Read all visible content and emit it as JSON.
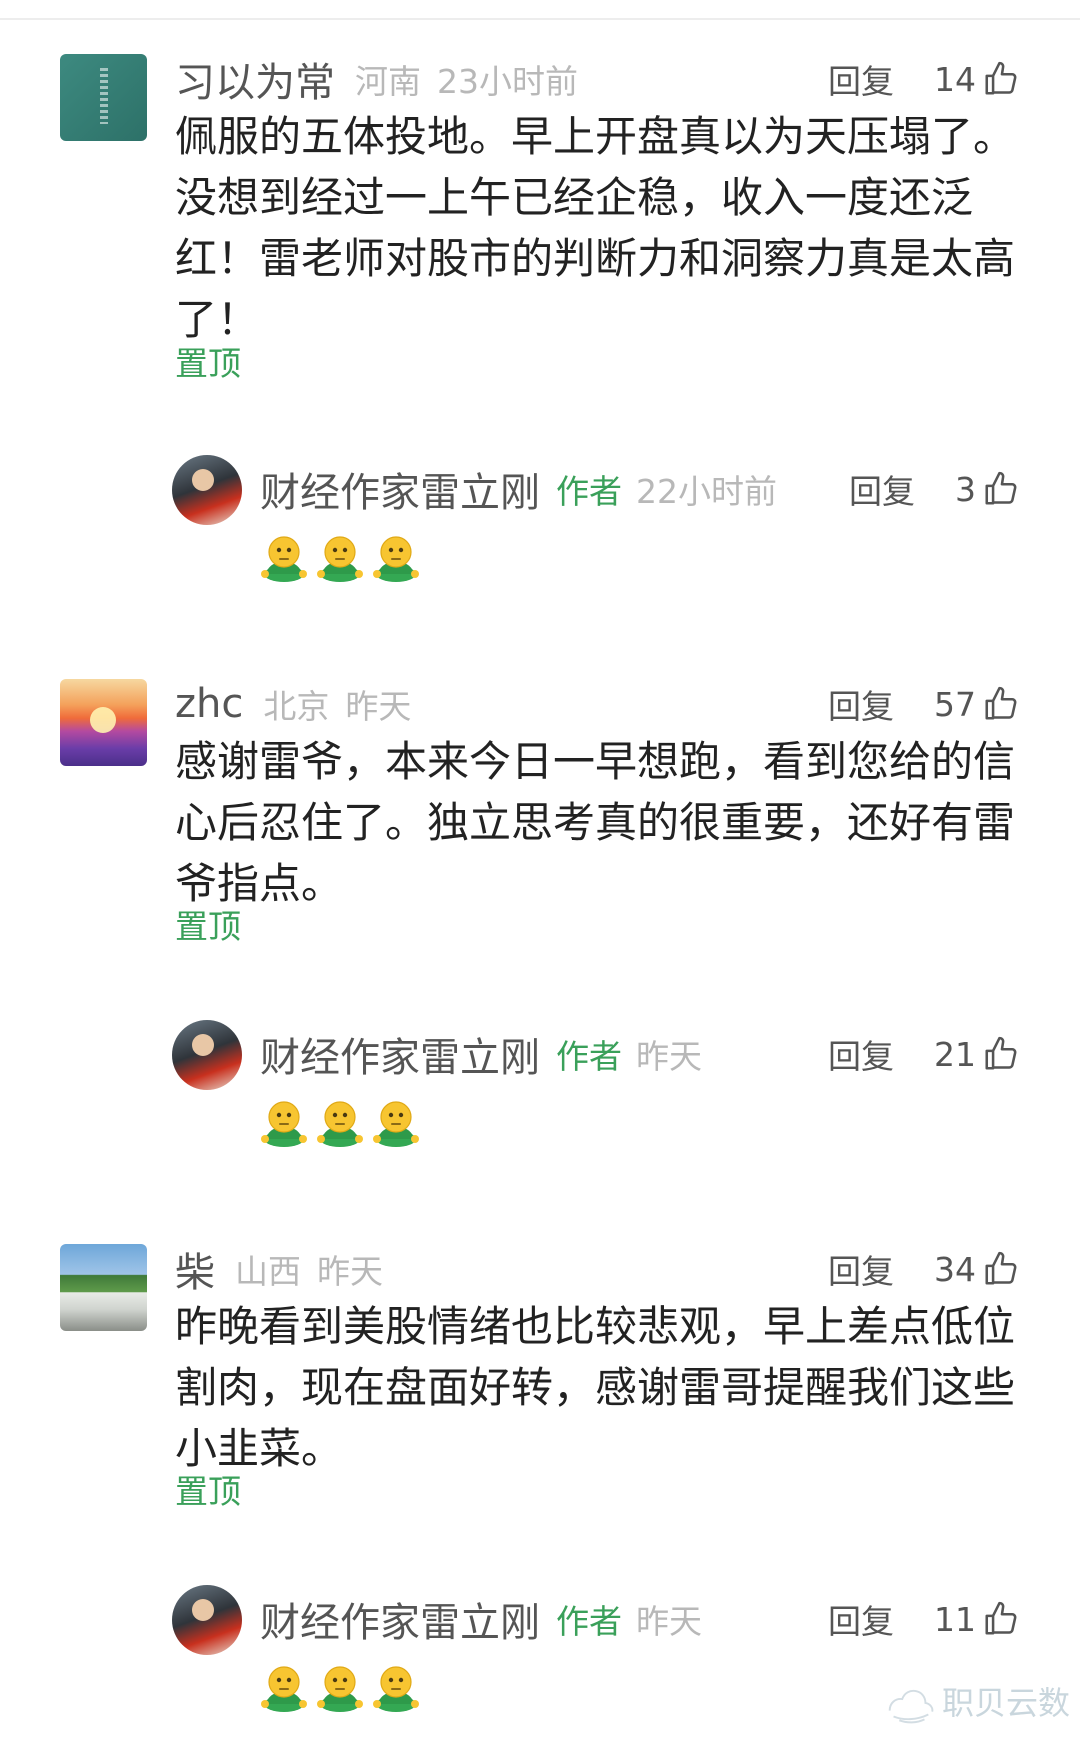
{
  "comments": [
    {
      "username": "习以为常",
      "location": "河南",
      "time": "23小时前",
      "reply_label": "回复",
      "likes": "14",
      "text": "佩服的五体投地。早上开盘真以为天压塌了。没想到经过一上午已经企稳，收入一度还泛红！雷老师对股市的判断力和洞察力真是太高了！",
      "pin_label": "置顶",
      "author_reply": {
        "username": "财经作家雷立刚",
        "author_tag": "作者",
        "time": "22小时前",
        "reply_label": "回复",
        "likes": "3",
        "emoji_count": 3
      }
    },
    {
      "username": "zhc",
      "location": "北京",
      "time": "昨天",
      "reply_label": "回复",
      "likes": "57",
      "text": "感谢雷爷，本来今日一早想跑，看到您给的信心后忍住了。独立思考真的很重要，还好有雷爷指点。",
      "pin_label": "置顶",
      "author_reply": {
        "username": "财经作家雷立刚",
        "author_tag": "作者",
        "time": "昨天",
        "reply_label": "回复",
        "likes": "21",
        "emoji_count": 3
      }
    },
    {
      "username": "柴",
      "location": "山西",
      "time": "昨天",
      "reply_label": "回复",
      "likes": "34",
      "text": "昨晚看到美股情绪也比较悲观，早上差点低位割肉，现在盘面好转，感谢雷哥提醒我们这些小韭菜。",
      "pin_label": "置顶",
      "author_reply": {
        "username": "财经作家雷立刚",
        "author_tag": "作者",
        "time": "昨天",
        "reply_label": "回复",
        "likes": "11",
        "emoji_count": 3
      }
    }
  ],
  "watermark": "职贝云数",
  "colors": {
    "accent_green": "#3aa05a",
    "meta_gray": "#b8b8b8",
    "name_gray": "#555555"
  }
}
